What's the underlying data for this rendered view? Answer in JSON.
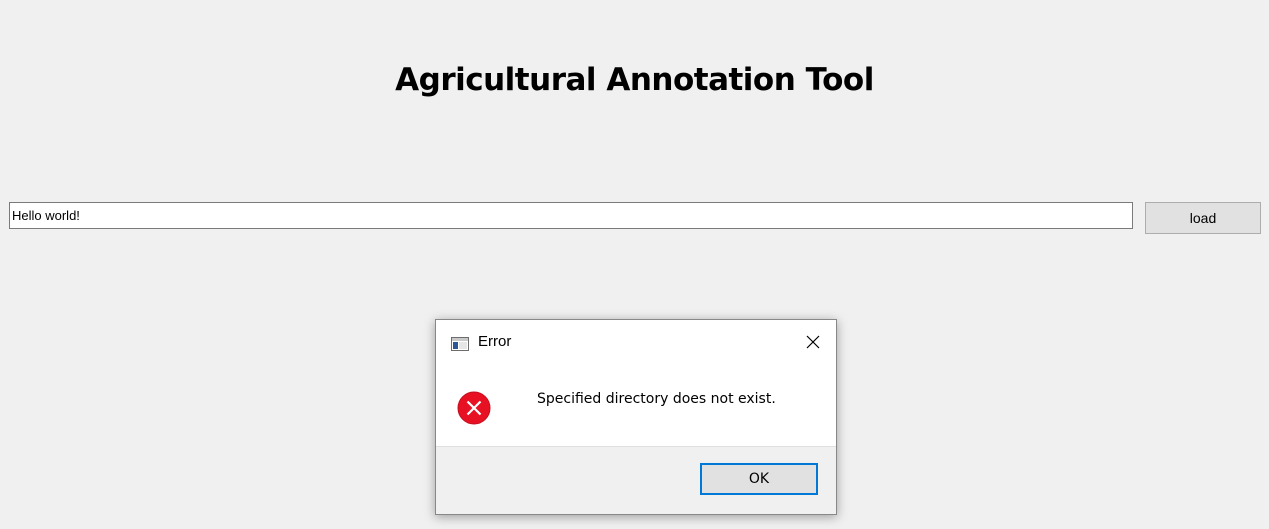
{
  "app": {
    "title": "Agricultural Annotation Tool"
  },
  "path_bar": {
    "input_value": "Hello world!",
    "load_label": "load"
  },
  "error_dialog": {
    "title": "Error",
    "message": "Specified directory does not exist.",
    "ok_label": "OK",
    "icon": "error-icon",
    "accent_color": "#0078d7",
    "error_color": "#e81123"
  }
}
